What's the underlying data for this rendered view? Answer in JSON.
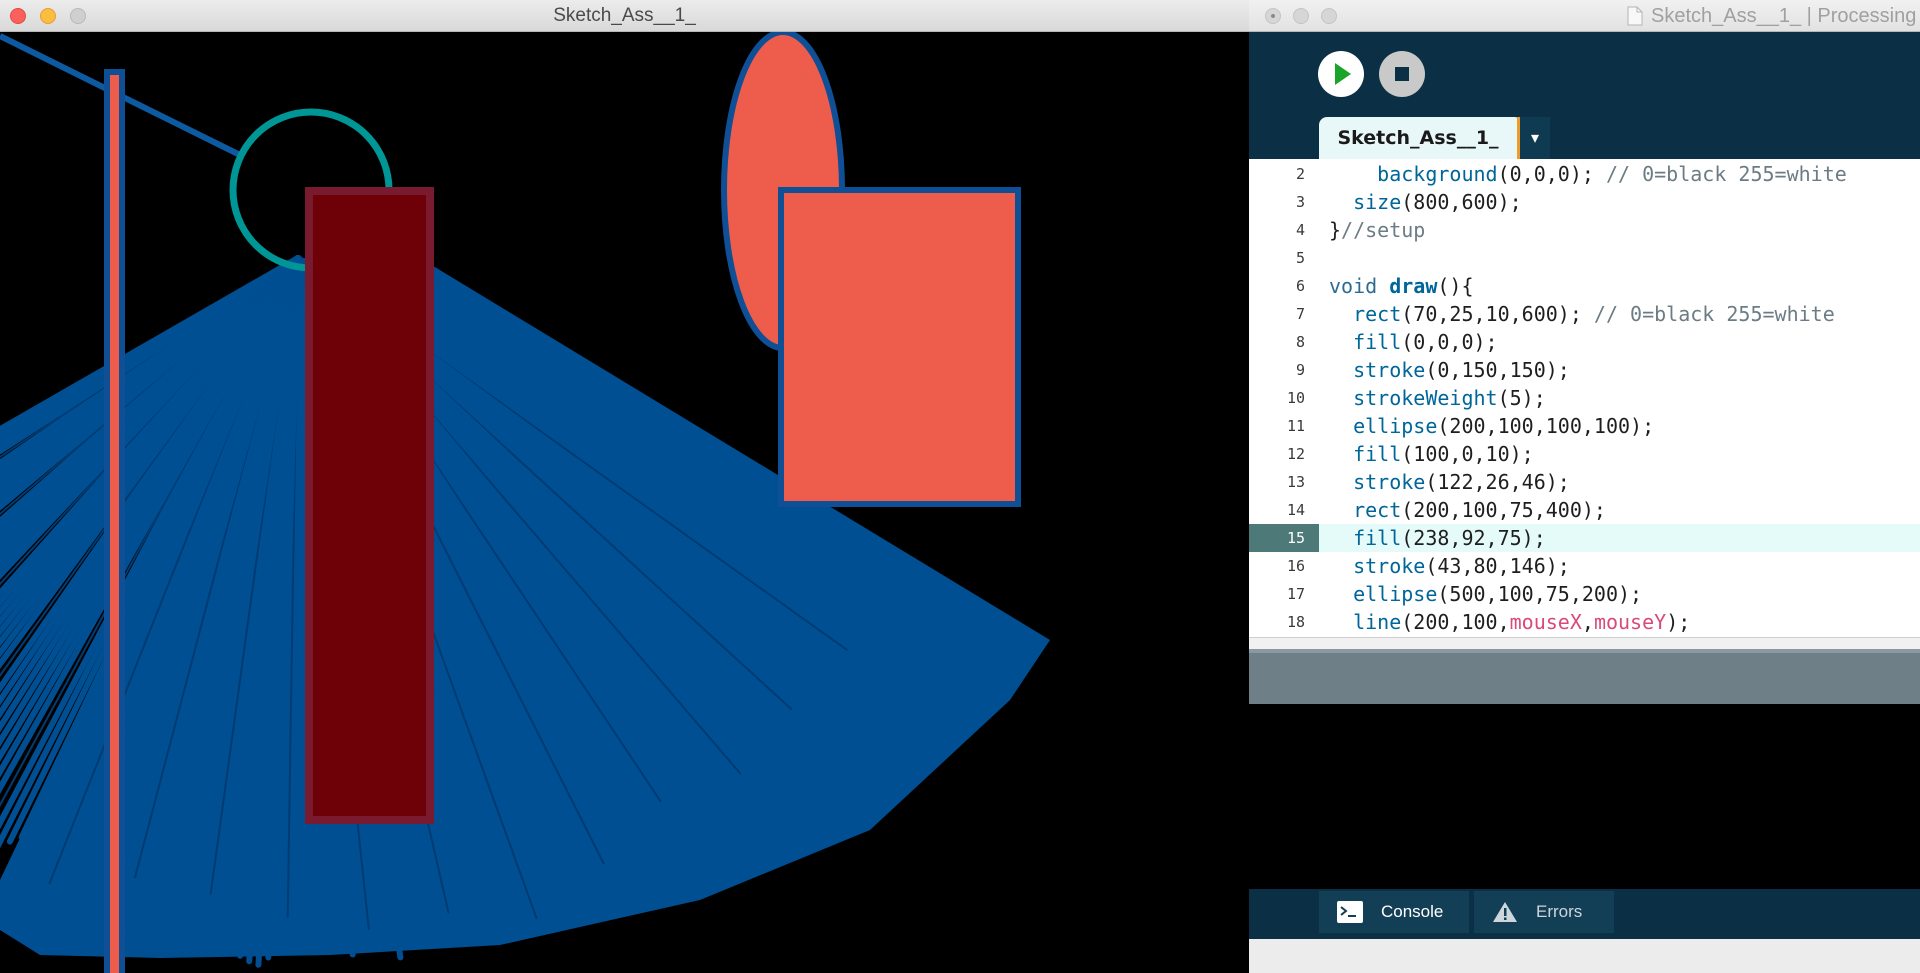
{
  "sketch_window": {
    "title": "Sketch_Ass__1_"
  },
  "ide_window": {
    "title": "Sketch_Ass__1_ | Processing",
    "toolbar": {
      "run_icon": "play-icon",
      "stop_icon": "stop-icon"
    },
    "tab": {
      "label": "Sketch_Ass__1_",
      "dropdown": "▾"
    },
    "current_line": 15,
    "code_lines": [
      {
        "num": "2",
        "tokens": [
          [
            "p",
            "    "
          ],
          [
            "fn",
            "background"
          ],
          [
            "p",
            "(0,0,0); "
          ],
          [
            "cm",
            "// 0=black 255=white"
          ]
        ]
      },
      {
        "num": "3",
        "tokens": [
          [
            "p",
            "  "
          ],
          [
            "fn",
            "size"
          ],
          [
            "p",
            "(800,600);"
          ]
        ]
      },
      {
        "num": "4",
        "tokens": [
          [
            "p",
            "}"
          ],
          [
            "cm",
            "//setup"
          ]
        ]
      },
      {
        "num": "5",
        "tokens": []
      },
      {
        "num": "6",
        "tokens": [
          [
            "kw",
            "void "
          ],
          [
            "bold",
            "draw"
          ],
          [
            "p",
            "(){"
          ]
        ]
      },
      {
        "num": "7",
        "tokens": [
          [
            "p",
            "  "
          ],
          [
            "fn",
            "rect"
          ],
          [
            "p",
            "(70,25,10,600); "
          ],
          [
            "cm",
            "// 0=black 255=white"
          ]
        ]
      },
      {
        "num": "8",
        "tokens": [
          [
            "p",
            "  "
          ],
          [
            "fn",
            "fill"
          ],
          [
            "p",
            "(0,0,0);"
          ]
        ]
      },
      {
        "num": "9",
        "tokens": [
          [
            "p",
            "  "
          ],
          [
            "fn",
            "stroke"
          ],
          [
            "p",
            "(0,150,150);"
          ]
        ]
      },
      {
        "num": "10",
        "tokens": [
          [
            "p",
            "  "
          ],
          [
            "fn",
            "strokeWeight"
          ],
          [
            "p",
            "(5);"
          ]
        ]
      },
      {
        "num": "11",
        "tokens": [
          [
            "p",
            "  "
          ],
          [
            "fn",
            "ellipse"
          ],
          [
            "p",
            "(200,100,100,100);"
          ]
        ]
      },
      {
        "num": "12",
        "tokens": [
          [
            "p",
            "  "
          ],
          [
            "fn",
            "fill"
          ],
          [
            "p",
            "(100,0,10);"
          ]
        ]
      },
      {
        "num": "13",
        "tokens": [
          [
            "p",
            "  "
          ],
          [
            "fn",
            "stroke"
          ],
          [
            "p",
            "(122,26,46);"
          ]
        ]
      },
      {
        "num": "14",
        "tokens": [
          [
            "p",
            "  "
          ],
          [
            "fn",
            "rect"
          ],
          [
            "p",
            "(200,100,75,400);"
          ]
        ]
      },
      {
        "num": "15",
        "tokens": [
          [
            "p",
            "  "
          ],
          [
            "fn",
            "fill"
          ],
          [
            "p",
            "(238,92,75);"
          ]
        ]
      },
      {
        "num": "16",
        "tokens": [
          [
            "p",
            "  "
          ],
          [
            "fn",
            "stroke"
          ],
          [
            "p",
            "(43,80,146);"
          ]
        ]
      },
      {
        "num": "17",
        "tokens": [
          [
            "p",
            "  "
          ],
          [
            "fn",
            "ellipse"
          ],
          [
            "p",
            "(500,100,75,200);"
          ]
        ]
      },
      {
        "num": "18",
        "tokens": [
          [
            "p",
            "  "
          ],
          [
            "fn",
            "line"
          ],
          [
            "p",
            "(200,100,"
          ],
          [
            "var",
            "mouseX"
          ],
          [
            "p",
            ","
          ],
          [
            "var",
            "mouseY"
          ],
          [
            "p",
            ");"
          ]
        ]
      }
    ],
    "bottom_tabs": {
      "console_label": "Console",
      "console_icon": "terminal-icon",
      "errors_label": "Errors",
      "errors_icon": "warning-icon"
    }
  },
  "colors": {
    "canvas_background": "#000000",
    "stroke_blue": "#2b5092",
    "fan_blue": "#004f93",
    "coral_fill": "#ee5c4b",
    "dark_red_fill": "#6e0008",
    "dark_red_stroke": "#7a1a2e",
    "teal_stroke": "#009696",
    "ide_dark": "#0b2f44",
    "tab_light": "#e8f8f9",
    "tab_accent": "#ef9b2c"
  }
}
